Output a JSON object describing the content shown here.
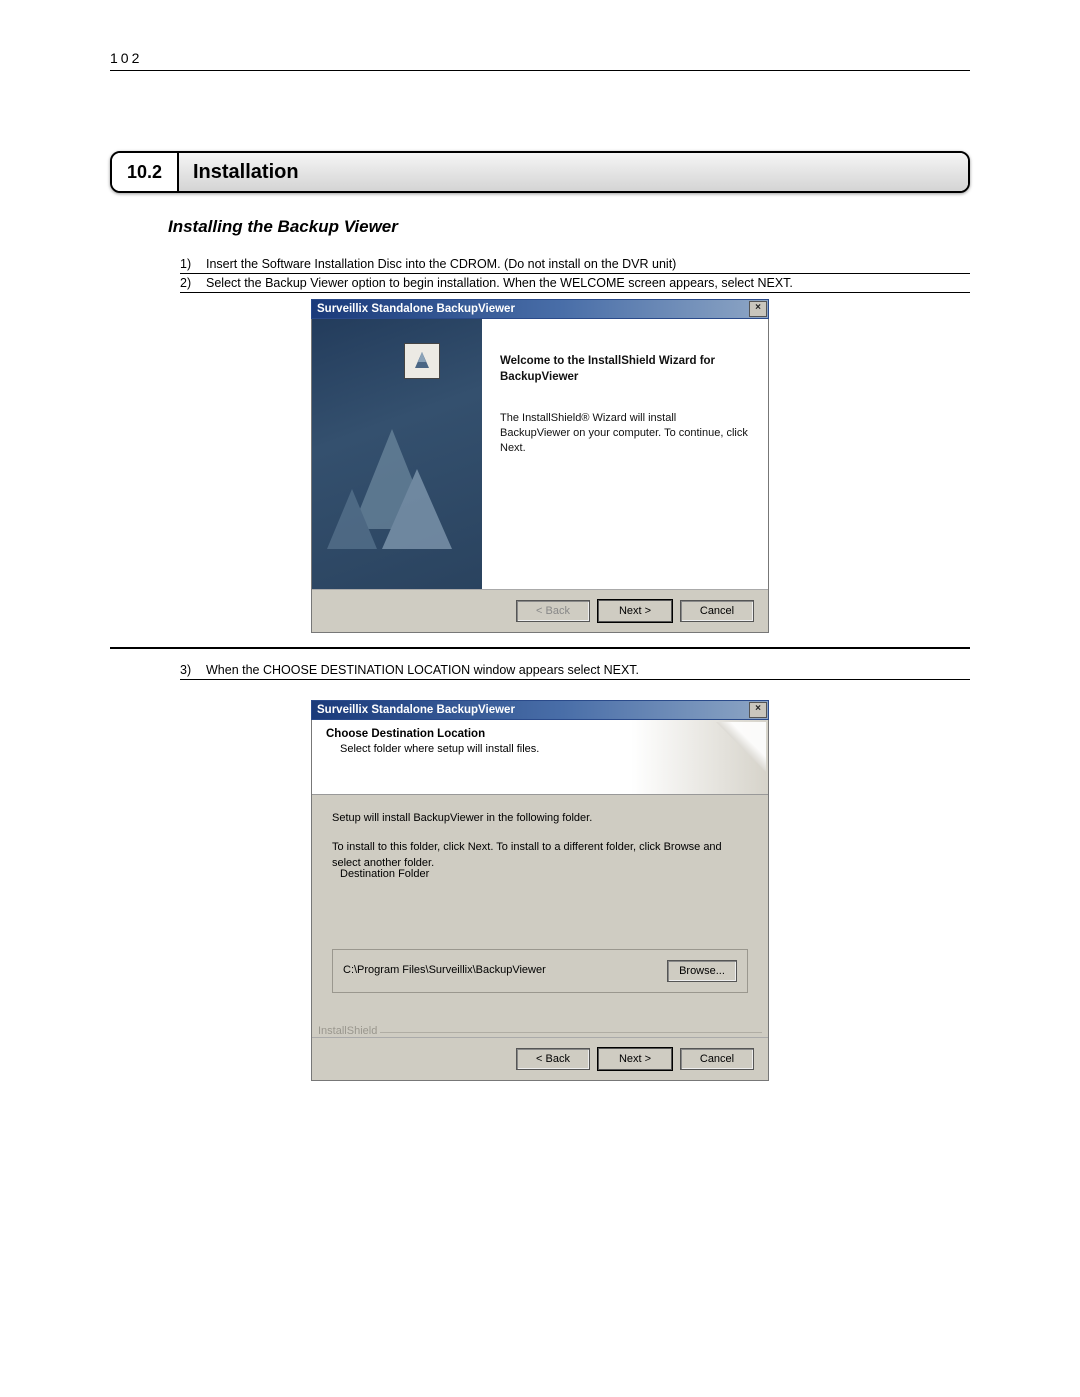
{
  "pageNumber": "102",
  "section": {
    "number": "10.2",
    "title": "Installation"
  },
  "subheading": "Installing the Backup Viewer",
  "steps": {
    "s1_num": "1)",
    "s1": "Insert the Software Installation Disc into the CDROM. (Do not install on the DVR unit)",
    "s2_num": "2)",
    "s2": "Select the Backup Viewer option to begin installation. When the WELCOME screen appears, select NEXT.",
    "s3_num": "3)",
    "s3": "When the CHOOSE DESTINATION LOCATION window appears select NEXT."
  },
  "dialog1": {
    "title": "Surveillix Standalone BackupViewer",
    "close": "×",
    "heading1": "Welcome to the InstallShield Wizard for",
    "heading2": "BackupViewer",
    "desc": "The InstallShield® Wizard will install BackupViewer on your computer.  To continue, click Next.",
    "btnBack": "< Back",
    "btnNext": "Next >",
    "btnCancel": "Cancel"
  },
  "dialog2": {
    "title": "Surveillix Standalone BackupViewer",
    "close": "×",
    "h1": "Choose Destination Location",
    "h2": "Select folder where setup will install files.",
    "p1": "Setup will install BackupViewer in the following folder.",
    "p2": "To install to this folder, click Next. To install to a different folder, click Browse and select another folder.",
    "fieldsetLabel": "Destination Folder",
    "path": "C:\\Program Files\\Surveillix\\BackupViewer",
    "browse": "Browse...",
    "installShield": "InstallShield",
    "btnBack": "< Back",
    "btnNext": "Next >",
    "btnCancel": "Cancel"
  }
}
